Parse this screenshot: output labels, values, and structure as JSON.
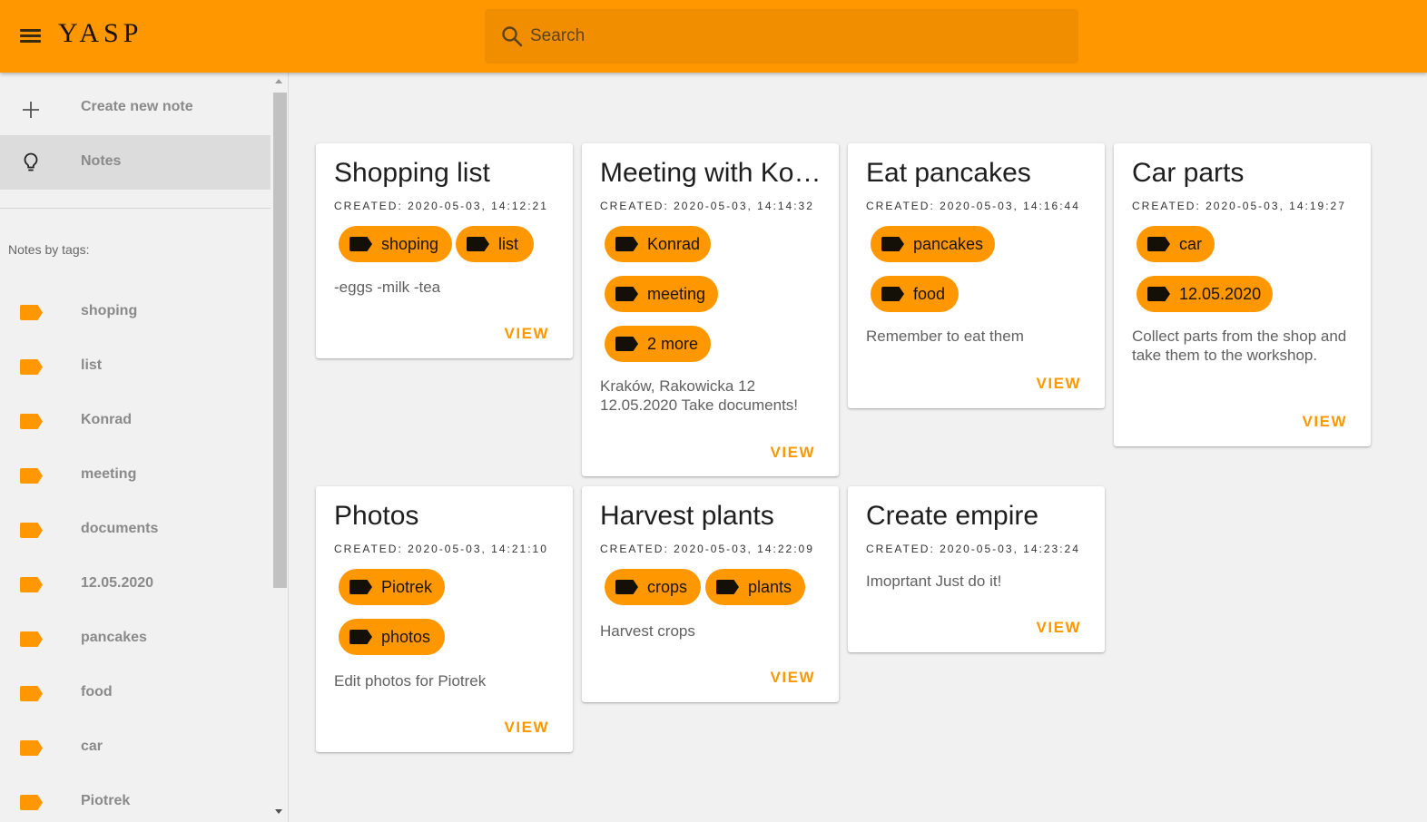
{
  "header": {
    "menu_icon": "menu-icon",
    "app_name": "YASP",
    "search_placeholder": "Search",
    "search_icon": "search-icon",
    "accent_color": "#ff9800"
  },
  "sidebar": {
    "create_label": "Create new note",
    "notes_label": "Notes",
    "tags_heading": "Notes by tags:",
    "tags": [
      "shoping",
      "list",
      "Konrad",
      "meeting",
      "documents",
      "12.05.2020",
      "pancakes",
      "food",
      "car",
      "Piotrek"
    ]
  },
  "notes": [
    {
      "title": "Shopping list",
      "created": "CREATED: 2020-05-03, 14:12:21",
      "tags": [
        "shoping",
        "list"
      ],
      "body": "-eggs -milk -tea",
      "action": "VIEW"
    },
    {
      "title": "Meeting with Konrad",
      "created": "CREATED: 2020-05-03, 14:14:32",
      "tags": [
        "Konrad",
        "meeting",
        "2 more"
      ],
      "body": "Kraków, Rakowicka 12\n12.05.2020 Take documents!",
      "action": "VIEW"
    },
    {
      "title": "Eat pancakes",
      "created": "CREATED: 2020-05-03, 14:16:44",
      "tags": [
        "pancakes",
        "food"
      ],
      "body": "Remember to eat them",
      "action": "VIEW"
    },
    {
      "title": "Car parts",
      "created": "CREATED: 2020-05-03, 14:19:27",
      "tags": [
        "car",
        "12.05.2020"
      ],
      "body": "Collect parts from the shop and take them to the workshop.",
      "action": "VIEW"
    },
    {
      "title": "Photos",
      "created": "CREATED: 2020-05-03, 14:21:10",
      "tags": [
        "Piotrek",
        "photos"
      ],
      "body": "Edit photos for Piotrek",
      "action": "VIEW"
    },
    {
      "title": "Harvest plants",
      "created": "CREATED: 2020-05-03, 14:22:09",
      "tags": [
        "crops",
        "plants"
      ],
      "body": "Harvest crops",
      "action": "VIEW"
    },
    {
      "title": "Create empire",
      "created": "CREATED: 2020-05-03, 14:23:24",
      "tags": [],
      "body": "Imoprtant Just do it!",
      "action": "VIEW"
    }
  ]
}
